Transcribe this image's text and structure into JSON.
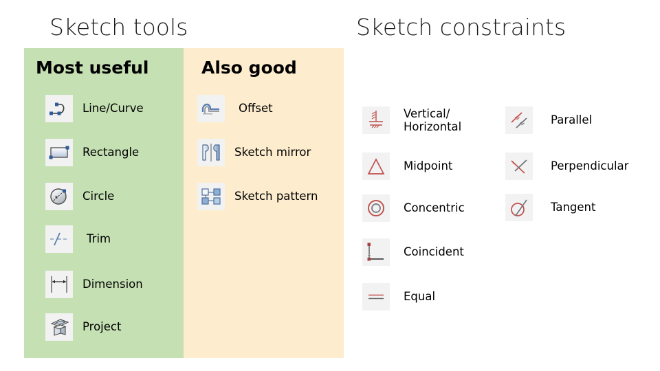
{
  "slide": {
    "titles": {
      "left": "Sketch tools",
      "right": "Sketch constraints"
    }
  },
  "colors": {
    "panel_green": "#C5E0B3",
    "panel_cream": "#FDEDCE",
    "icon_chip": "#F2F2F2",
    "constraint_red": "#C0504D",
    "tool_blue": "#4472A8",
    "text": "#000000",
    "background": "#FFFFFF"
  },
  "tools_panel": {
    "most_useful": {
      "heading": "Most useful",
      "items": [
        {
          "label": "Line/Curve",
          "icon": "line-curve-icon"
        },
        {
          "label": "Rectangle",
          "icon": "rectangle-icon"
        },
        {
          "label": "Circle",
          "icon": "circle-icon"
        },
        {
          "label": "Trim",
          "icon": "trim-icon"
        },
        {
          "label": "Dimension",
          "icon": "dimension-icon"
        },
        {
          "label": "Project",
          "icon": "project-icon"
        }
      ]
    },
    "also_good": {
      "heading": "Also good",
      "items": [
        {
          "label": "Offset",
          "icon": "offset-icon"
        },
        {
          "label": "Sketch mirror",
          "icon": "sketch-mirror-icon"
        },
        {
          "label": "Sketch pattern",
          "icon": "sketch-pattern-icon"
        }
      ]
    }
  },
  "constraints_panel": {
    "column_a": [
      {
        "label": "Vertical/ Horizontal",
        "icon": "vertical-horizontal-icon"
      },
      {
        "label": "Midpoint",
        "icon": "midpoint-icon"
      },
      {
        "label": "Concentric",
        "icon": "concentric-icon"
      },
      {
        "label": "Coincident",
        "icon": "coincident-icon"
      },
      {
        "label": "Equal",
        "icon": "equal-icon"
      }
    ],
    "column_b": [
      {
        "label": "Parallel",
        "icon": "parallel-icon"
      },
      {
        "label": "Perpendicular",
        "icon": "perpendicular-icon"
      },
      {
        "label": "Tangent",
        "icon": "tangent-icon"
      }
    ]
  }
}
